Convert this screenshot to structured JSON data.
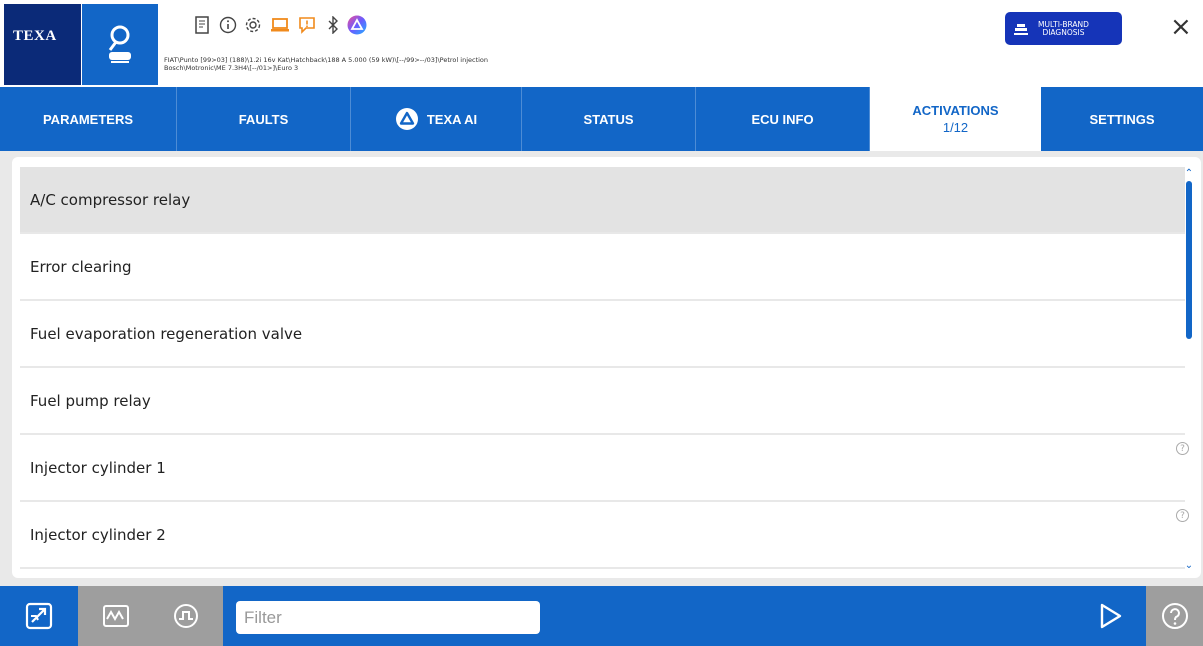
{
  "header": {
    "brand": "TEXA",
    "vehicle_line1": "FIAT\\Punto [99>03] (188)\\1.2i 16v Kat\\Hatchback\\188 A 5.000 (59 kW)\\[--/99>--/03]\\Petrol injection",
    "vehicle_line2": "Bosch\\Motronic\\ME 7.3H4\\[--/01>]\\Euro 3",
    "multibrand_line1": "MULTI-BRAND",
    "multibrand_line2": "DIAGNOSIS",
    "close": "×"
  },
  "tabs": [
    {
      "label": "PARAMETERS"
    },
    {
      "label": "FAULTS"
    },
    {
      "label": "TEXA AI"
    },
    {
      "label": "STATUS"
    },
    {
      "label": "ECU INFO"
    },
    {
      "label": "ACTIVATIONS",
      "sub": "1/12"
    },
    {
      "label": "SETTINGS"
    }
  ],
  "activations": [
    {
      "label": "A/C compressor relay",
      "selected": true
    },
    {
      "label": "Error clearing"
    },
    {
      "label": "Fuel evaporation regeneration valve"
    },
    {
      "label": "Fuel pump relay"
    },
    {
      "label": "Injector cylinder 1",
      "help": "?"
    },
    {
      "label": "Injector cylinder 2",
      "help": "?"
    }
  ],
  "bottom": {
    "filter_placeholder": "Filter"
  },
  "colors": {
    "brand_dark": "#0b2a78",
    "accent_blue": "#1266c7",
    "multibrand_blue": "#1534b8",
    "disabled_grey": "#9e9e9e"
  },
  "icons": [
    "search-car-icon",
    "document-icon",
    "info-icon",
    "gear-icon",
    "laptop-icon",
    "alert-icon",
    "bluetooth-icon",
    "texa-ai-icon",
    "car-lift-icon",
    "close-icon",
    "activations-icon",
    "waveform-icon",
    "oscilloscope-icon",
    "play-icon",
    "help-icon"
  ]
}
